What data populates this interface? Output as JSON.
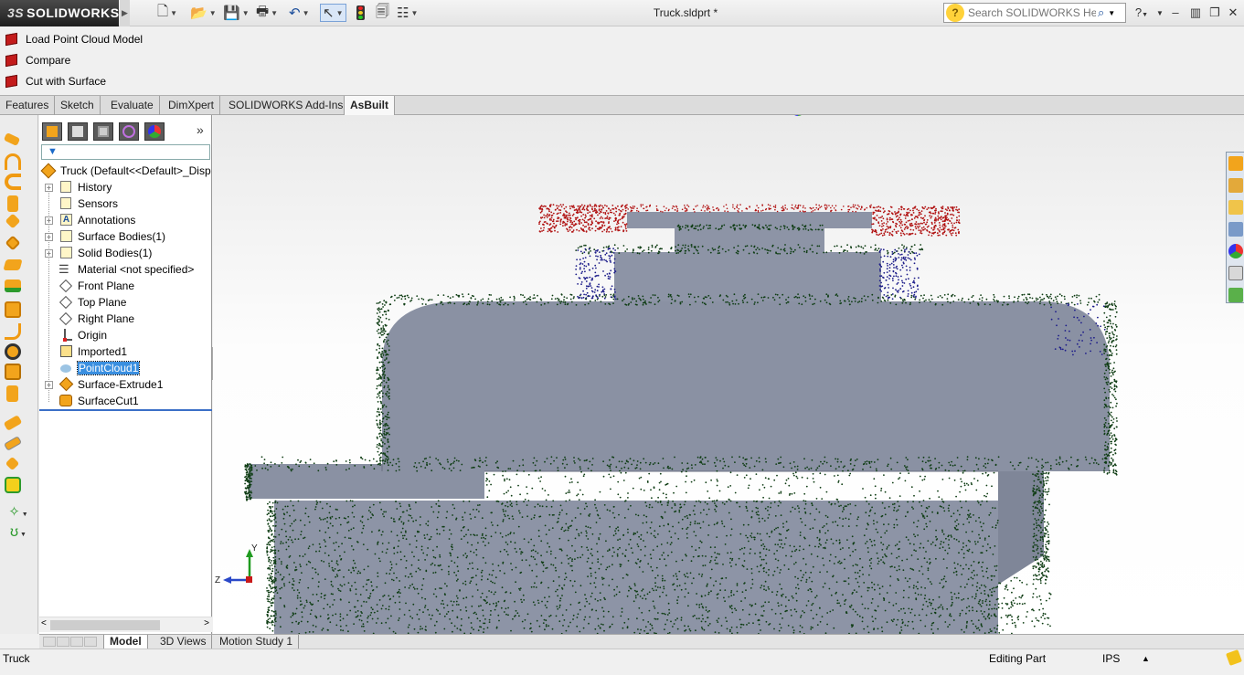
{
  "app": {
    "logo_text": "SOLIDWORKS",
    "logo_prefix": "3S",
    "document_title": "Truck.sldprt *"
  },
  "search": {
    "placeholder": "Search SOLIDWORKS Help"
  },
  "command_manager": {
    "items": [
      {
        "label": "Load Point Cloud Model"
      },
      {
        "label": "Compare"
      },
      {
        "label": "Cut with Surface"
      }
    ]
  },
  "tabs": [
    {
      "label": "Features"
    },
    {
      "label": "Sketch"
    },
    {
      "label": "Evaluate"
    },
    {
      "label": "DimXpert"
    },
    {
      "label": "SOLIDWORKS Add-Ins"
    },
    {
      "label": "AsBuilt",
      "active": true
    }
  ],
  "feature_tree": {
    "root": "Truck  (Default<<Default>_Disp",
    "nodes": [
      {
        "label": "History",
        "icon": "history-icon",
        "expandable": true
      },
      {
        "label": "Sensors",
        "icon": "sensor-icon",
        "expandable": false
      },
      {
        "label": "Annotations",
        "icon": "annotation-icon",
        "expandable": true
      },
      {
        "label": "Surface Bodies(1)",
        "icon": "surface-bodies-icon",
        "expandable": true
      },
      {
        "label": "Solid Bodies(1)",
        "icon": "solid-bodies-icon",
        "expandable": true
      },
      {
        "label": "Material <not specified>",
        "icon": "material-icon",
        "expandable": false
      },
      {
        "label": "Front Plane",
        "icon": "plane-icon",
        "expandable": false
      },
      {
        "label": "Top Plane",
        "icon": "plane-icon",
        "expandable": false
      },
      {
        "label": "Right Plane",
        "icon": "plane-icon",
        "expandable": false
      },
      {
        "label": "Origin",
        "icon": "origin-icon",
        "expandable": false
      },
      {
        "label": "Imported1",
        "icon": "imported-icon",
        "expandable": false
      },
      {
        "label": "PointCloud1",
        "icon": "point-cloud-icon",
        "expandable": false,
        "selected": true
      },
      {
        "label": "Surface-Extrude1",
        "icon": "surface-extrude-icon",
        "expandable": true
      },
      {
        "label": "SurfaceCut1",
        "icon": "surface-cut-icon",
        "expandable": false
      }
    ]
  },
  "triad": {
    "y": "Y",
    "z": "Z"
  },
  "bottom_tabs": [
    {
      "label": "Model",
      "active": true
    },
    {
      "label": "3D Views"
    },
    {
      "label": "Motion Study 1"
    }
  ],
  "status": {
    "left": "Truck",
    "mode": "Editing Part",
    "units": "IPS"
  },
  "colors": {
    "model_face": "#8d94a6",
    "points_green": "#0f3d14",
    "points_red": "#b11313",
    "points_blue": "#1d1d8a",
    "selection": "#3a8fe0"
  }
}
